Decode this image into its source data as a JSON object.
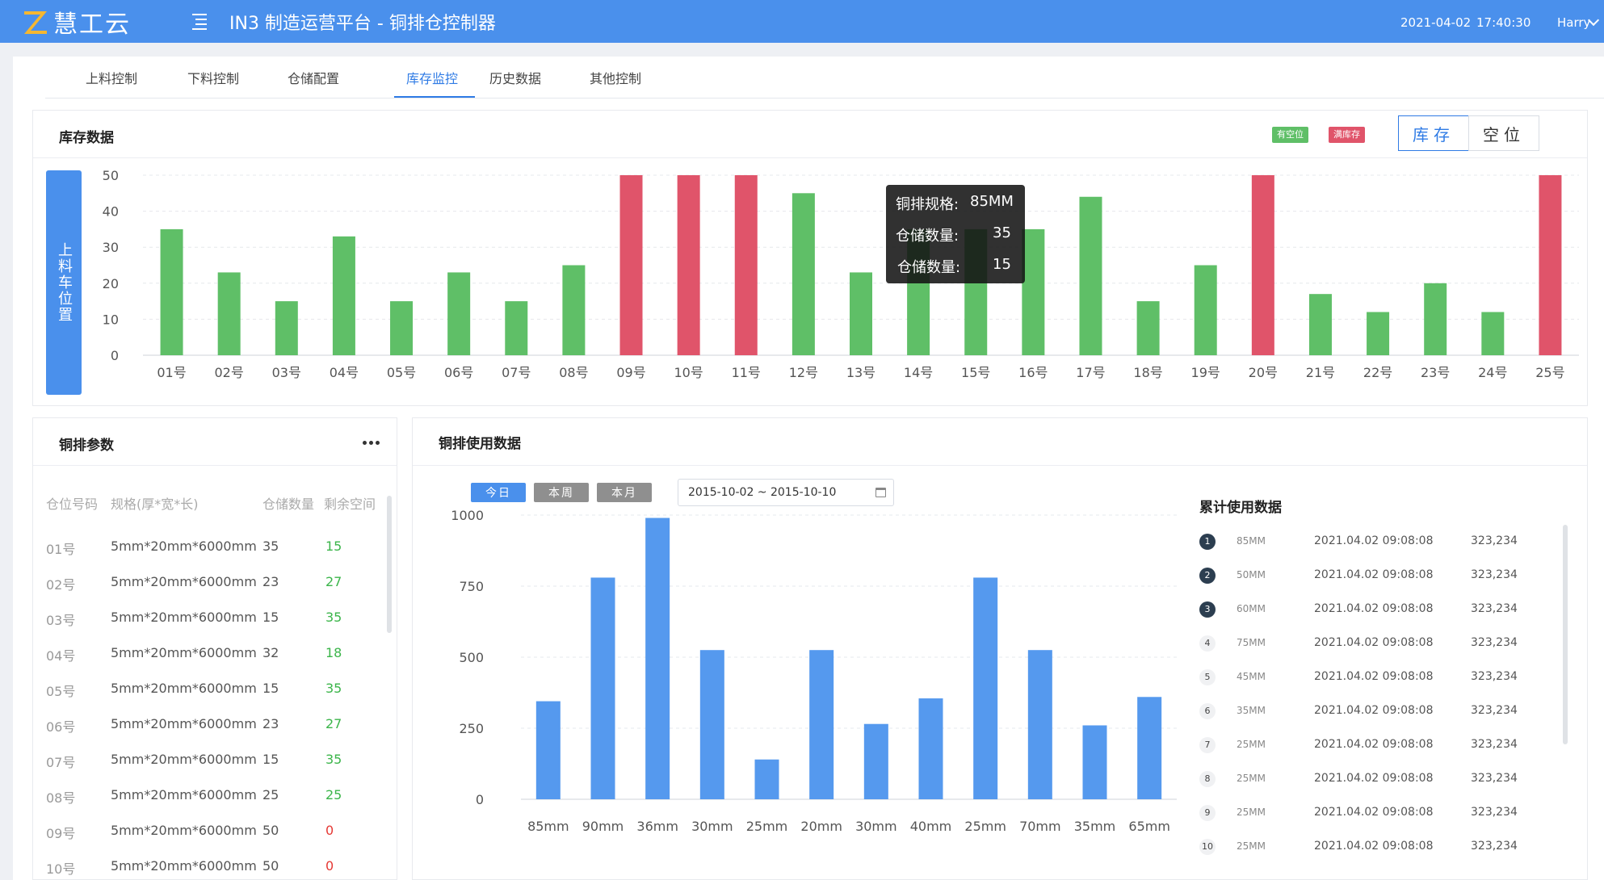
{
  "header": {
    "logo_text": "慧工云",
    "title": "IN3 制造运营平台 - 铜排仓控制器",
    "date": "2021-04-02",
    "time": "17:40:30",
    "user": "Harry"
  },
  "tabs": [
    {
      "label": "上料控制"
    },
    {
      "label": "下料控制"
    },
    {
      "label": "仓储配置"
    },
    {
      "label": "库存监控",
      "active": true
    },
    {
      "label": "历史数据"
    },
    {
      "label": "其他控制"
    }
  ],
  "inventory": {
    "title": "库存数据",
    "legend_free": "有空位",
    "legend_full": "满库存",
    "toggle_stock": "库存",
    "toggle_empty": "空位",
    "feeder_label": "上料车位置",
    "tooltip": {
      "spec_label": "铜排规格:",
      "spec_value": "85MM",
      "qty_label_1": "仓储数量:",
      "qty_value_1": "35",
      "qty_label_2": "仓储数量:",
      "qty_value_2": "15"
    }
  },
  "params": {
    "title": "铜排参数",
    "columns": [
      "仓位号码",
      "规格(厚*宽*长)",
      "仓储数量",
      "剩余空间"
    ],
    "rows": [
      {
        "slot": "01号",
        "spec": "5mm*20mm*6000mm",
        "qty": "35",
        "free": "15"
      },
      {
        "slot": "02号",
        "spec": "5mm*20mm*6000mm",
        "qty": "23",
        "free": "27"
      },
      {
        "slot": "03号",
        "spec": "5mm*20mm*6000mm",
        "qty": "15",
        "free": "35"
      },
      {
        "slot": "04号",
        "spec": "5mm*20mm*6000mm",
        "qty": "32",
        "free": "18"
      },
      {
        "slot": "05号",
        "spec": "5mm*20mm*6000mm",
        "qty": "15",
        "free": "35"
      },
      {
        "slot": "06号",
        "spec": "5mm*20mm*6000mm",
        "qty": "23",
        "free": "27"
      },
      {
        "slot": "07号",
        "spec": "5mm*20mm*6000mm",
        "qty": "15",
        "free": "35"
      },
      {
        "slot": "08号",
        "spec": "5mm*20mm*6000mm",
        "qty": "25",
        "free": "25"
      },
      {
        "slot": "09号",
        "spec": "5mm*20mm*6000mm",
        "qty": "50",
        "free": "0"
      },
      {
        "slot": "10号",
        "spec": "5mm*20mm*6000mm",
        "qty": "50",
        "free": "0"
      }
    ]
  },
  "usage": {
    "title": "铜排使用数据",
    "btn_today": "今日",
    "btn_week": "本周",
    "btn_month": "本月",
    "date_range": "2015-10-02  ~ 2015-10-10",
    "ranking_title": "累计使用数据",
    "ranking": [
      {
        "rank": "1",
        "spec": "85MM",
        "time": "2021.04.02 09:08:08",
        "value": "323,234"
      },
      {
        "rank": "2",
        "spec": "50MM",
        "time": "2021.04.02 09:08:08",
        "value": "323,234"
      },
      {
        "rank": "3",
        "spec": "60MM",
        "time": "2021.04.02 09:08:08",
        "value": "323,234"
      },
      {
        "rank": "4",
        "spec": "75MM",
        "time": "2021.04.02 09:08:08",
        "value": "323,234"
      },
      {
        "rank": "5",
        "spec": "45MM",
        "time": "2021.04.02 09:08:08",
        "value": "323,234"
      },
      {
        "rank": "6",
        "spec": "35MM",
        "time": "2021.04.02 09:08:08",
        "value": "323,234"
      },
      {
        "rank": "7",
        "spec": "25MM",
        "time": "2021.04.02 09:08:08",
        "value": "323,234"
      },
      {
        "rank": "8",
        "spec": "25MM",
        "time": "2021.04.02 09:08:08",
        "value": "323,234"
      },
      {
        "rank": "9",
        "spec": "25MM",
        "time": "2021.04.02 09:08:08",
        "value": "323,234"
      },
      {
        "rank": "10",
        "spec": "25MM",
        "time": "2021.04.02 09:08:08",
        "value": "323,234"
      }
    ]
  },
  "colors": {
    "brand": "#4a90ec",
    "accent": "#2f7be5",
    "bar_free": "#5fbf67",
    "bar_full": "#e0546a",
    "bar_usage": "#5599ee",
    "qty_ok": "#3bb54a",
    "qty_zero": "#e53935",
    "btn_inactive": "#8f8f8f",
    "rank_top": "#2c3e50"
  },
  "chart_data": [
    {
      "type": "bar",
      "categories": [
        "01号",
        "02号",
        "03号",
        "04号",
        "05号",
        "06号",
        "07号",
        "08号",
        "09号",
        "10号",
        "11号",
        "12号",
        "13号",
        "14号",
        "15号",
        "16号",
        "17号",
        "18号",
        "19号",
        "20号",
        "21号",
        "22号",
        "23号",
        "24号",
        "25号"
      ],
      "values": [
        35,
        23,
        15,
        33,
        15,
        23,
        15,
        25,
        50,
        50,
        50,
        45,
        23,
        35,
        35,
        35,
        44,
        15,
        25,
        50,
        17,
        12,
        20,
        12,
        50
      ],
      "full": [
        false,
        false,
        false,
        false,
        false,
        false,
        false,
        false,
        true,
        true,
        true,
        false,
        false,
        false,
        false,
        false,
        false,
        false,
        false,
        true,
        false,
        false,
        false,
        false,
        true
      ],
      "yticks": [
        0,
        10,
        20,
        30,
        40,
        50
      ],
      "ylim": [
        0,
        50
      ]
    },
    {
      "type": "bar",
      "categories": [
        "85mm",
        "90mm",
        "36mm",
        "30mm",
        "25mm",
        "20mm",
        "30mm",
        "40mm",
        "25mm",
        "70mm",
        "35mm",
        "65mm"
      ],
      "values": [
        345,
        780,
        990,
        525,
        140,
        525,
        265,
        355,
        780,
        525,
        260,
        360
      ],
      "yticks": [
        0,
        250,
        500,
        750,
        1000
      ],
      "ylim": [
        0,
        1000
      ]
    }
  ]
}
